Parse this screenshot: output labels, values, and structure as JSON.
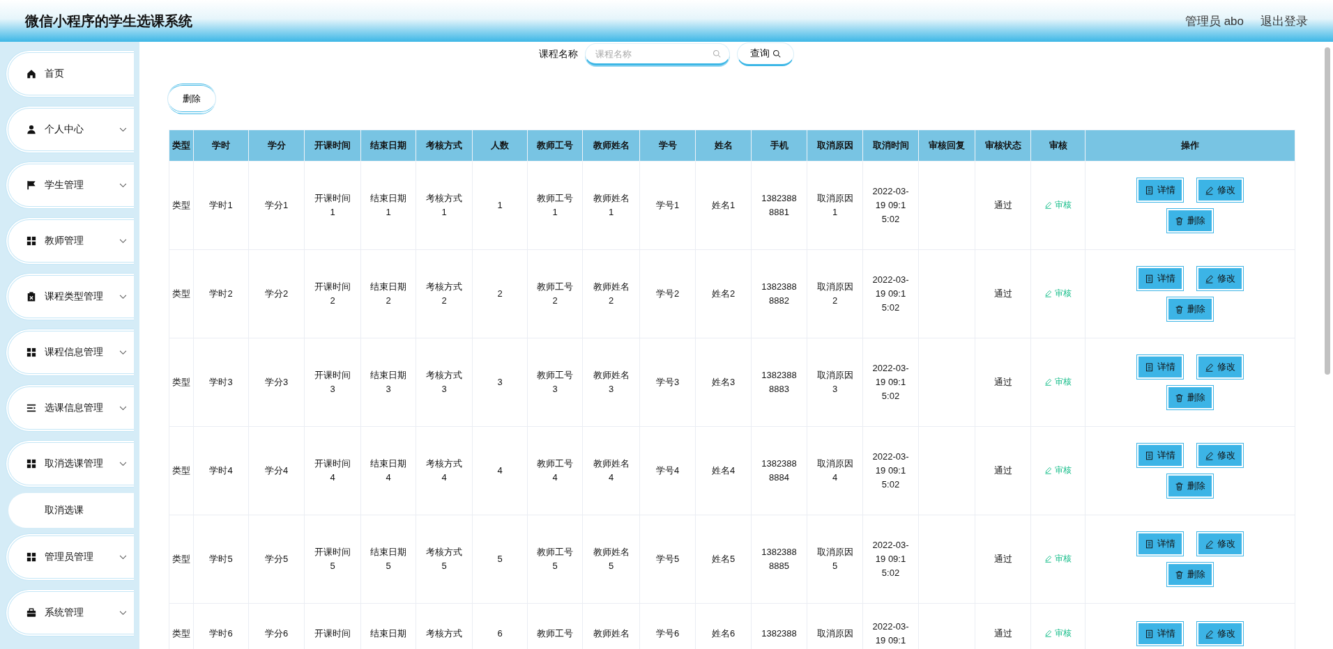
{
  "header": {
    "title": "微信小程序的学生选课系统",
    "user": "管理员 abo",
    "logout": "退出登录"
  },
  "sidebar": {
    "items": [
      {
        "label": "首页",
        "kind": "home",
        "has_arrow": false
      },
      {
        "label": "个人中心",
        "kind": "person",
        "has_arrow": true
      },
      {
        "label": "学生管理",
        "kind": "flag",
        "has_arrow": true
      },
      {
        "label": "教师管理",
        "kind": "grid",
        "has_arrow": true
      },
      {
        "label": "课程类型管理",
        "kind": "clipboard",
        "has_arrow": true
      },
      {
        "label": "课程信息管理",
        "kind": "grid",
        "has_arrow": true
      },
      {
        "label": "选课信息管理",
        "kind": "list",
        "has_arrow": true
      },
      {
        "label": "取消选课管理",
        "kind": "grid",
        "has_arrow": true,
        "children": [
          {
            "label": "取消选课"
          }
        ]
      },
      {
        "label": "管理员管理",
        "kind": "grid",
        "has_arrow": true
      },
      {
        "label": "系统管理",
        "kind": "briefcase",
        "has_arrow": true
      }
    ]
  },
  "search": {
    "label": "课程名称",
    "placeholder": "课程名称",
    "button": "查询"
  },
  "toolbar": {
    "delete_button": "删除"
  },
  "table": {
    "columns": [
      "类型",
      "学时",
      "学分",
      "开课时间",
      "结束日期",
      "考核方式",
      "人数",
      "教师工号",
      "教师姓名",
      "学号",
      "姓名",
      "手机",
      "取消原因",
      "取消时间",
      "审核回复",
      "审核状态",
      "审核",
      "操作"
    ],
    "rows": [
      {
        "cells": [
          "类型",
          "学时1",
          "学分1",
          "开课时间1",
          "结束日期1",
          "考核方式1",
          "1",
          "教师工号1",
          "教师姓名1",
          "学号1",
          "姓名1",
          "13823888881",
          "取消原因1",
          "2022-03-19 09:15:02",
          null,
          "通过"
        ],
        "review": "审核",
        "actions": [
          {
            "kind": "detail",
            "label": "详情"
          },
          {
            "kind": "edit",
            "label": "修改"
          },
          {
            "kind": "delete",
            "label": "删除"
          }
        ]
      },
      {
        "cells": [
          "类型",
          "学时2",
          "学分2",
          "开课时间2",
          "结束日期2",
          "考核方式2",
          "2",
          "教师工号2",
          "教师姓名2",
          "学号2",
          "姓名2",
          "13823888882",
          "取消原因2",
          "2022-03-19 09:15:02",
          null,
          "通过"
        ],
        "review": "审核",
        "actions": [
          {
            "kind": "detail",
            "label": "详情"
          },
          {
            "kind": "edit",
            "label": "修改"
          },
          {
            "kind": "delete",
            "label": "删除"
          }
        ]
      },
      {
        "cells": [
          "类型",
          "学时3",
          "学分3",
          "开课时间3",
          "结束日期3",
          "考核方式3",
          "3",
          "教师工号3",
          "教师姓名3",
          "学号3",
          "姓名3",
          "13823888883",
          "取消原因3",
          "2022-03-19 09:15:02",
          null,
          "通过"
        ],
        "review": "审核",
        "actions": [
          {
            "kind": "detail",
            "label": "详情"
          },
          {
            "kind": "edit",
            "label": "修改"
          },
          {
            "kind": "delete",
            "label": "删除"
          }
        ]
      },
      {
        "cells": [
          "类型",
          "学时4",
          "学分4",
          "开课时间4",
          "结束日期4",
          "考核方式4",
          "4",
          "教师工号4",
          "教师姓名4",
          "学号4",
          "姓名4",
          "13823888884",
          "取消原因4",
          "2022-03-19 09:15:02",
          null,
          "通过"
        ],
        "review": "审核",
        "actions": [
          {
            "kind": "detail",
            "label": "详情"
          },
          {
            "kind": "edit",
            "label": "修改"
          },
          {
            "kind": "delete",
            "label": "删除"
          }
        ]
      },
      {
        "cells": [
          "类型",
          "学时5",
          "学分5",
          "开课时间5",
          "结束日期5",
          "考核方式5",
          "5",
          "教师工号5",
          "教师姓名5",
          "学号5",
          "姓名5",
          "13823888885",
          "取消原因5",
          "2022-03-19 09:15:02",
          null,
          "通过"
        ],
        "review": "审核",
        "actions": [
          {
            "kind": "detail",
            "label": "详情"
          },
          {
            "kind": "edit",
            "label": "修改"
          },
          {
            "kind": "delete",
            "label": "删除"
          }
        ]
      },
      {
        "cells": [
          "类型",
          "学时6",
          "学分6",
          "开课时间",
          "结束日期",
          "考核方式",
          "6",
          "教师工号",
          "教师姓名",
          "学号6",
          "姓名6",
          "1382388",
          "取消原因",
          "2022-03-19 09:1",
          null,
          "通过"
        ],
        "review": "审核",
        "actions": [
          {
            "kind": "detail",
            "label": "详情"
          },
          {
            "kind": "edit",
            "label": "修改"
          }
        ]
      }
    ]
  }
}
